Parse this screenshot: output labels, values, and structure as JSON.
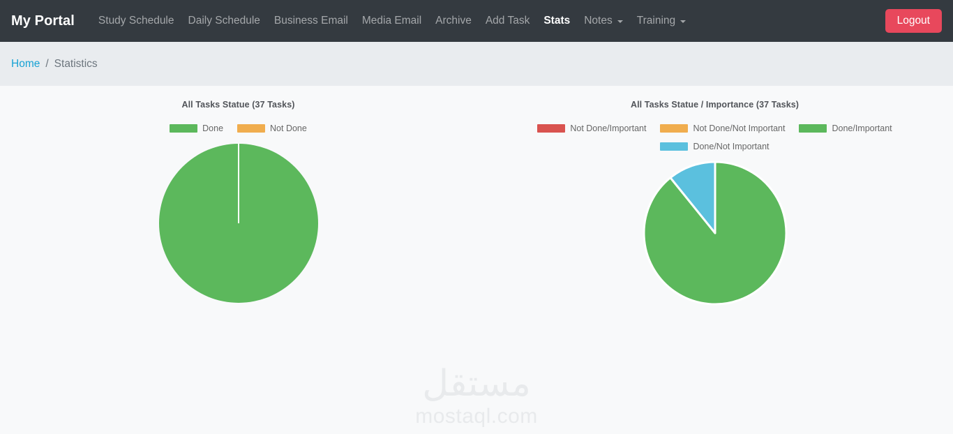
{
  "navbar": {
    "brand": "My Portal",
    "items": [
      {
        "label": "Study Schedule",
        "active": false,
        "caret": false
      },
      {
        "label": "Daily Schedule",
        "active": false,
        "caret": false
      },
      {
        "label": "Business Email",
        "active": false,
        "caret": false
      },
      {
        "label": "Media Email",
        "active": false,
        "caret": false
      },
      {
        "label": "Archive",
        "active": false,
        "caret": false
      },
      {
        "label": "Add Task",
        "active": false,
        "caret": false
      },
      {
        "label": "Stats",
        "active": true,
        "caret": false
      },
      {
        "label": "Notes",
        "active": false,
        "caret": true
      },
      {
        "label": "Training",
        "active": false,
        "caret": true
      }
    ],
    "logout_label": "Logout",
    "bg_color": "#343a40",
    "logout_color": "#e8485c"
  },
  "breadcrumb": {
    "home_label": "Home",
    "separator": "/",
    "current_label": "Statistics"
  },
  "watermark": {
    "arabic": "مستقل",
    "latin": "mostaql.com"
  },
  "colors": {
    "done_green": "#5cb85c",
    "not_done_orange": "#f0ad4e",
    "not_done_important_red": "#d9534f",
    "done_not_important_blue": "#5bc0de",
    "slice_border": "#ffffff",
    "body_bg": "#f8f9fa",
    "breadcrumb_bg": "#e9ecef"
  },
  "chart_data": [
    {
      "type": "pie",
      "title": "All Tasks Statue (37 Tasks)",
      "total": 37,
      "categories": [
        "Done",
        "Not Done"
      ],
      "values": [
        37,
        0
      ],
      "colors": [
        "#5cb85c",
        "#f0ad4e"
      ],
      "legend_position": "top",
      "start_angle": 0,
      "radius": 114,
      "center": [
        300,
        315
      ]
    },
    {
      "type": "pie",
      "title": "All Tasks Statue / Importance (37 Tasks)",
      "total": 37,
      "categories": [
        "Not Done/Important",
        "Not Done/Not Important",
        "Done/Important",
        "Done/Not Important"
      ],
      "values": [
        0,
        0,
        33,
        4
      ],
      "colors": [
        "#d9534f",
        "#f0ad4e",
        "#5cb85c",
        "#5bc0de"
      ],
      "legend_position": "top",
      "start_angle": 0,
      "radius": 102,
      "center": [
        900,
        325
      ]
    }
  ]
}
